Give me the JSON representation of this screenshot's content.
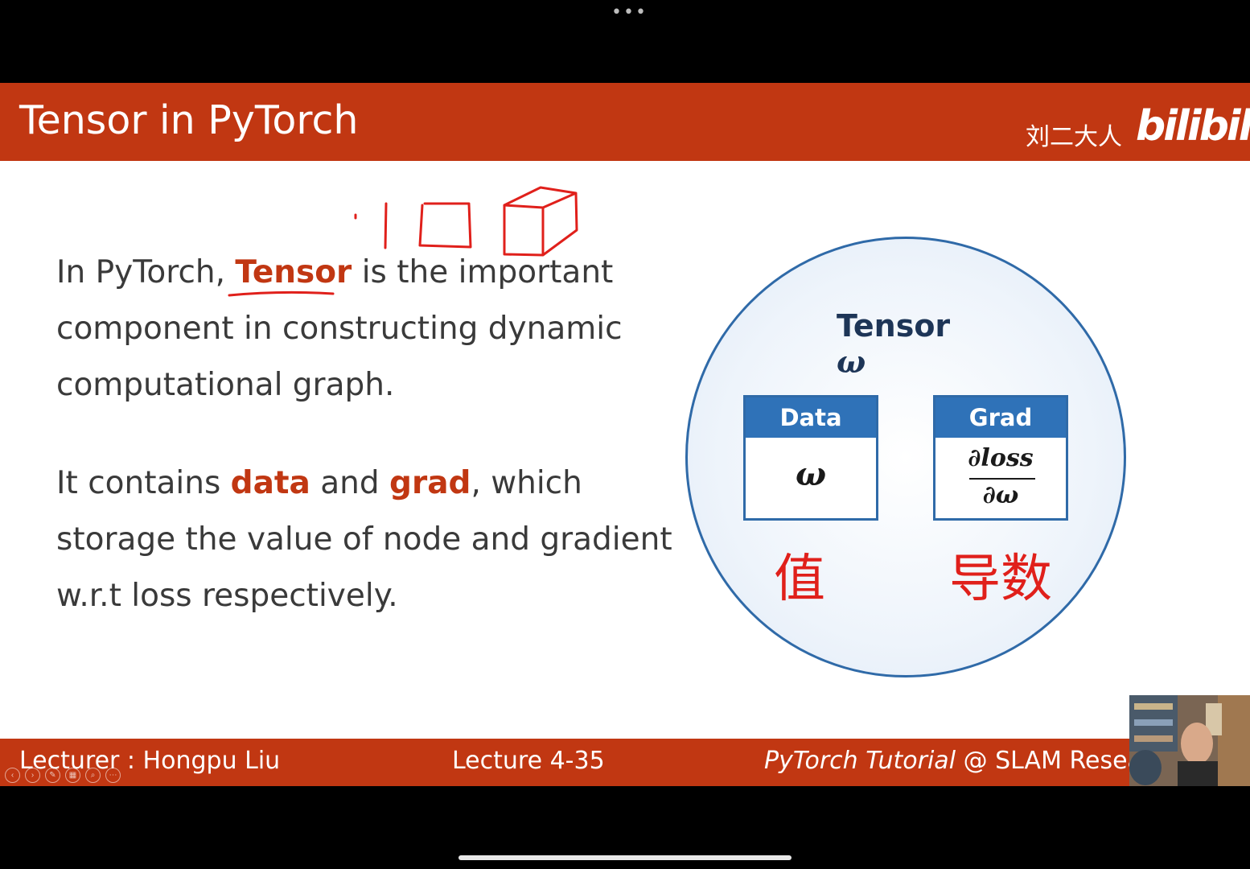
{
  "window": {
    "menu_dots": "•••"
  },
  "slide": {
    "title": "Tensor in PyTorch",
    "brand_cn": "刘二大人",
    "brand_logo": "bilibili",
    "paragraph1": {
      "before": "In PyTorch, ",
      "keyword": "Tensor",
      "after": " is the important component in constructing dynamic computational graph."
    },
    "paragraph2": {
      "part1": "It contains ",
      "kw1": "data",
      "part2": " and ",
      "kw2": "grad",
      "part3": ", which storage the value of node and gradient w.r.t loss respectively."
    },
    "diagram": {
      "title": "Tensor",
      "title_symbol": "ω",
      "data_box": {
        "header": "Data",
        "value": "ω"
      },
      "grad_box": {
        "header": "Grad",
        "numerator": "∂loss",
        "denominator": "∂ω"
      }
    },
    "handwriting": {
      "under_data": "值",
      "under_grad": "导数"
    },
    "footer": {
      "lecturer": "Lecturer : Hongpu Liu",
      "lecture_no": "Lecture 4-35",
      "right_italic": "PyTorch Tutorial",
      "right_rest": " @ SLAM Resear"
    }
  },
  "colors": {
    "accent": "#c13712",
    "blue": "#2f72b8",
    "circle_border": "#2f6aa8",
    "ink_red": "#e0201b"
  }
}
